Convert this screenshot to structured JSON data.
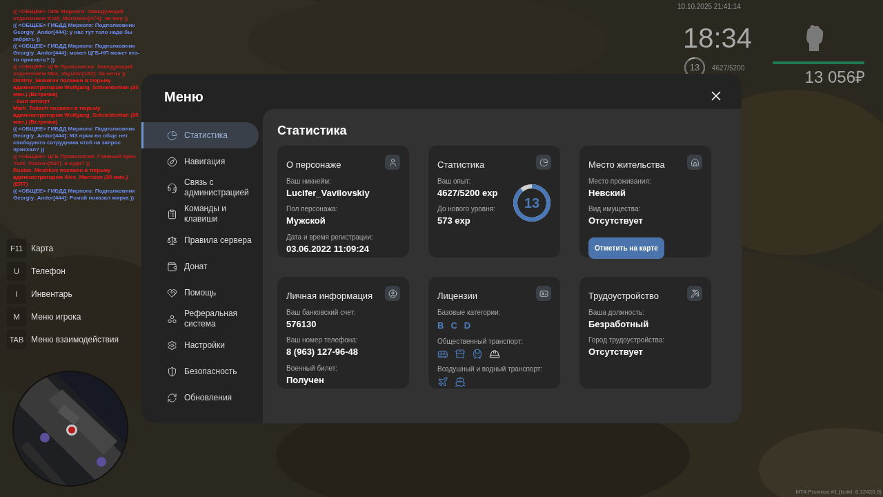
{
  "chat": [
    {
      "text": "(( <ОБЩЕЕ> ОКБ Мирного: Заведующий отделением Kirill_Morozaev[474]: на вму ))",
      "color": "#c62020"
    },
    {
      "text": "(( <ОБЩЕЕ> ГИБДД Мирного: Подполковник Georgiy_Andor[444]: у нас тут тело надо бы забрать ))",
      "color": "#6c8cf0"
    },
    {
      "text": "(( <ОБЩЕЕ> ГИБДД Мирного: Подполковник Georgiy_Andor[444]: может ЦГБ-НП может кто-то приехать? ))",
      "color": "#6c8cf0"
    },
    {
      "text": "(( <ОБЩЕЕ> ЦГБ Приволжска: Заведующий отделением Max_Vayukin[153]: За няты ))",
      "color": "#c62020"
    },
    {
      "text": "Dmitriy_Samarov посажен в тюрьму администратором Wolfgang_Schneiderhan (30 мин.) (Встречка)",
      "color": "#ff1a1a"
    },
    {
      "text": "- был заткнут",
      "color": "#ff1a1a"
    },
    {
      "text": "Mark_Tokach посажен в тюрьму администратором Wolfgang_Schneiderhan (30 мин.) (Встречка)",
      "color": "#ff1a1a"
    },
    {
      "text": "(( <ОБЩЕЕ> ГИБДД Мирного: Подполковник Georgiy_Andor[444]: МЗ прям во обще нет свободного сотрудника чтоб на запрос приехал? ))",
      "color": "#6c8cf0"
    },
    {
      "text": "(( <ОБЩЕЕ> ЦГБ Приволжска: Главный врач Yurii_Vostrov[530]: а куда? ))",
      "color": "#c62020"
    },
    {
      "text": "Ruslan_Meshkov посажен в тюрьму администратором Alex_Morrison (30 мин.) (ЕПТ)",
      "color": "#ff1a1a"
    },
    {
      "text": "(( <ОБЩЕЕ> ГИБДД Мирного: Подполковник Georgiy_Andor[444]: Рсмой показал мирка ))",
      "color": "#6c8cf0"
    }
  ],
  "hud": {
    "datetime": "10.10.2025 21:41:14",
    "clock": "18:34",
    "rank": {
      "value": "13",
      "level": 0.89
    },
    "xp": "4627/5200",
    "health": {
      "level": 1
    },
    "money": "13 056₽"
  },
  "hotkeys": [
    {
      "key": "F11",
      "label": "Карта"
    },
    {
      "key": "U",
      "label": "Телефон"
    },
    {
      "key": "I",
      "label": "Инвентарь"
    },
    {
      "key": "M",
      "label": "Меню игрока"
    },
    {
      "key": "TAB",
      "label": "Меню взаимодействия"
    }
  ],
  "menu": {
    "title": "Меню",
    "nav": [
      {
        "label": "Статистика",
        "selected": true
      },
      {
        "label": "Навигация",
        "selected": false
      },
      {
        "label": "Связь с администрацией",
        "selected": false
      },
      {
        "label": "Команды и клавиши",
        "selected": false
      },
      {
        "label": "Правила сервера",
        "selected": false
      },
      {
        "label": "Донат",
        "selected": false
      },
      {
        "label": "Помощь",
        "selected": false
      },
      {
        "label": "Реферальная система",
        "selected": false
      },
      {
        "label": "Настройки",
        "selected": false
      },
      {
        "label": "Безопасность",
        "selected": false
      },
      {
        "label": "Обновления",
        "selected": false
      }
    ],
    "page_title": "Статистика",
    "cards": [
      {
        "kind": "fields",
        "title": "О персонаже",
        "fields": [
          {
            "label": "Ваш никнейм:",
            "value": "Lucifer_Vavilovskiy"
          },
          {
            "label": "Пол персонажа:",
            "value": "Мужской"
          },
          {
            "label": "Дата и время регистрации:",
            "value": "03.06.2022 11:09:24"
          }
        ]
      },
      {
        "kind": "stats",
        "title": "Статистика",
        "fields": [
          {
            "label": "Ваш опыт:",
            "value": "4627/5200 exp"
          },
          {
            "label": "До нового уровня:",
            "value": "573 exp"
          }
        ],
        "ring": {
          "value": "13",
          "level": 0.89
        }
      },
      {
        "kind": "fields",
        "title": "Место жительства",
        "fields": [
          {
            "label": "Место проживания:",
            "value": "Невский"
          },
          {
            "label": "Вид имущества:",
            "value": "Отсутствует"
          }
        ],
        "button": "Отметить на карте"
      },
      {
        "kind": "fields",
        "title": "Личная информация",
        "fields": [
          {
            "label": "Ваш банковский счет:",
            "value": "576130"
          },
          {
            "label": "Ваш номер телефона:",
            "value": "8 (963) 127-96-48"
          },
          {
            "label": "Военный билет:",
            "value": "Получен"
          }
        ]
      },
      {
        "kind": "licenses",
        "title": "Лицензии",
        "sections": [
          {
            "kind": "letters",
            "label": "Базовые категории:",
            "items": [
              {
                "text": "B"
              },
              {
                "text": "C"
              },
              {
                "text": "D"
              }
            ]
          },
          {
            "kind": "icons",
            "label": "Общественный транспорт:",
            "items": [
              {
                "owned": true
              },
              {
                "owned": true
              },
              {
                "owned": true
              },
              {
                "owned": false
              }
            ]
          },
          {
            "kind": "icons",
            "label": "Воздушный и водный транспорт:",
            "items": [
              {
                "owned": true
              },
              {
                "owned": true
              }
            ]
          }
        ]
      },
      {
        "kind": "fields",
        "title": "Трудоустройство",
        "fields": [
          {
            "label": "Ваша должность:",
            "value": "Безработный"
          },
          {
            "label": "Город трудоустройства:",
            "value": "Отсутствует"
          }
        ]
      }
    ]
  },
  "build": "MTA Province #1 (build: 6.12420.9)"
}
